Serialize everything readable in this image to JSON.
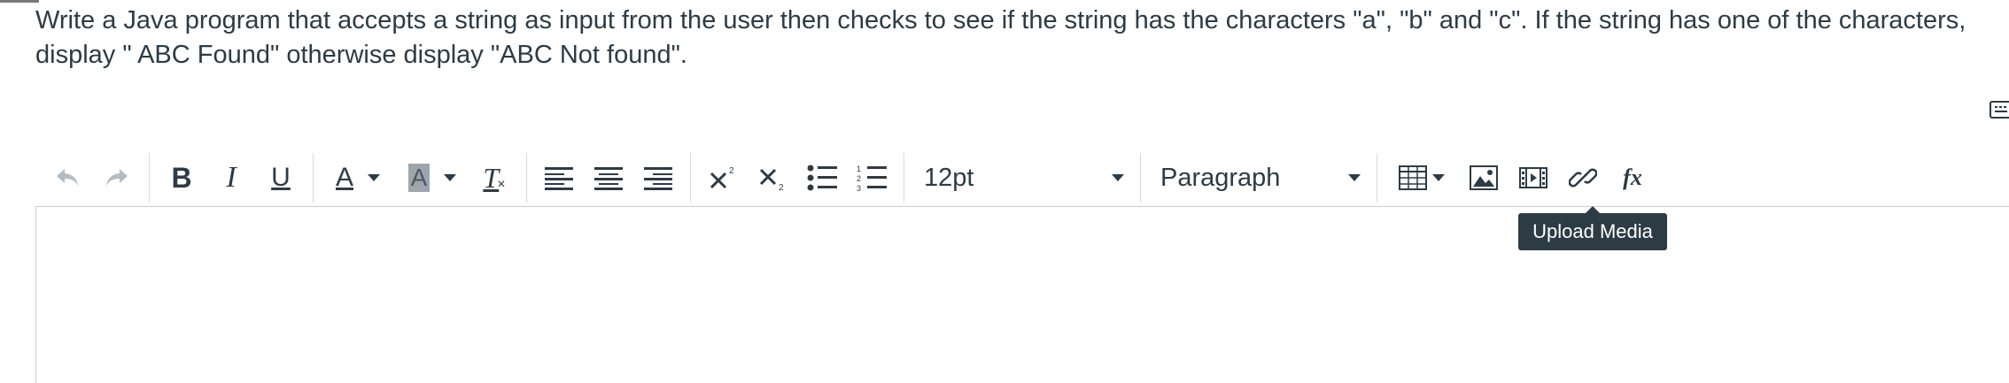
{
  "question": {
    "text": "Write a Java program that accepts a string as input from the user then checks to see if the string has the characters \"a\", \"b\" and \"c\". If the string has one of the characters, display  \" ABC Found\" otherwise display \"ABC Not found\"."
  },
  "toolbar": {
    "bold_label": "B",
    "italic_label": "I",
    "underline_label": "U",
    "text_color_label": "A",
    "highlight_label": "A",
    "clear_format_label": "T",
    "font_size": "12pt",
    "block_format": "Paragraph",
    "equation_label": "fx"
  },
  "tooltip": {
    "text": "Upload Media"
  },
  "colors": {
    "text": "#2d3b45",
    "disabled": "#b4bbc1",
    "tooltip_bg": "#2d3b45",
    "border": "#c7cdd1"
  }
}
